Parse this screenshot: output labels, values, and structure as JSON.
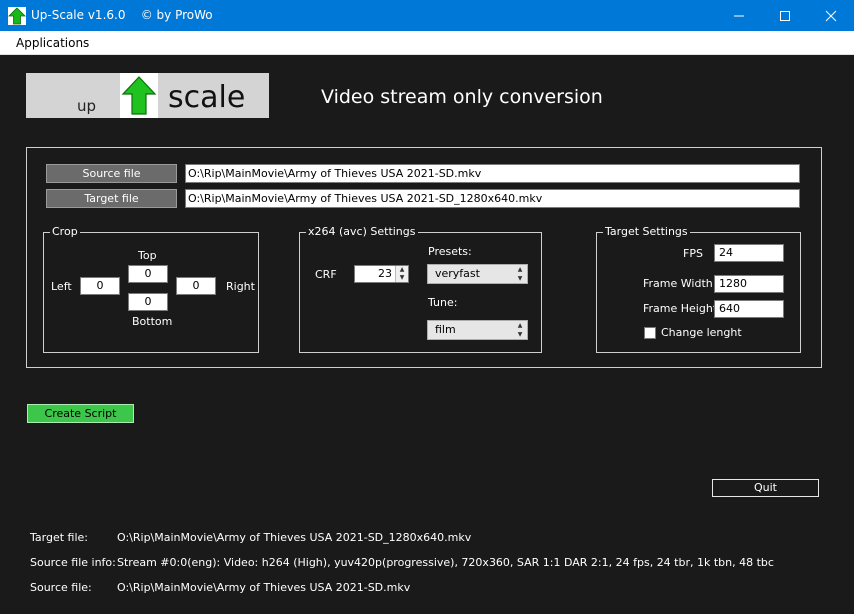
{
  "window": {
    "title": "Up-Scale v1.6.0    © by ProWo",
    "accent_color": "#0078d7",
    "icon": "green-up-arrow-icon"
  },
  "menu": {
    "applications": "Applications"
  },
  "logo": {
    "up": "up",
    "scale": "scale"
  },
  "heading": "Video stream only conversion",
  "files": {
    "source_button": "Source file",
    "source_path": "O:\\Rip\\MainMovie\\Army of Thieves USA 2021-SD.mkv",
    "target_button": "Target file",
    "target_path": "O:\\Rip\\MainMovie\\Army of Thieves USA 2021-SD_1280x640.mkv"
  },
  "crop": {
    "title": "Crop",
    "top_label": "Top",
    "top_value": "0",
    "left_label": "Left",
    "left_value": "0",
    "right_value": "0",
    "right_label": "Right",
    "bottom_value": "0",
    "bottom_label": "Bottom"
  },
  "x264": {
    "title": "x264 (avc) Settings",
    "crf_label": "CRF",
    "crf_value": "23",
    "presets_label": "Presets:",
    "preset_value": "veryfast",
    "tune_label": "Tune:",
    "tune_value": "film"
  },
  "target": {
    "title": "Target Settings",
    "fps_label": "FPS",
    "fps_value": "24",
    "width_label": "Frame Width",
    "width_value": "1280",
    "height_label": "Frame Height",
    "height_value": "640",
    "change_length_label": "Change lenght",
    "change_length_checked": false
  },
  "actions": {
    "create_script": "Create Script",
    "create_color": "#3cc64a",
    "quit": "Quit"
  },
  "info": {
    "target_label": "Target file:",
    "target_value": "O:\\Rip\\MainMovie\\Army of Thieves USA 2021-SD_1280x640.mkv",
    "source_info_label": "Source file info:",
    "source_info_value": "Stream #0:0(eng): Video: h264 (High), yuv420p(progressive), 720x360, SAR 1:1 DAR 2:1, 24 fps, 24 tbr, 1k tbn, 48 tbc",
    "source_label": "Source file:",
    "source_value": "O:\\Rip\\MainMovie\\Army of Thieves USA 2021-SD.mkv"
  }
}
